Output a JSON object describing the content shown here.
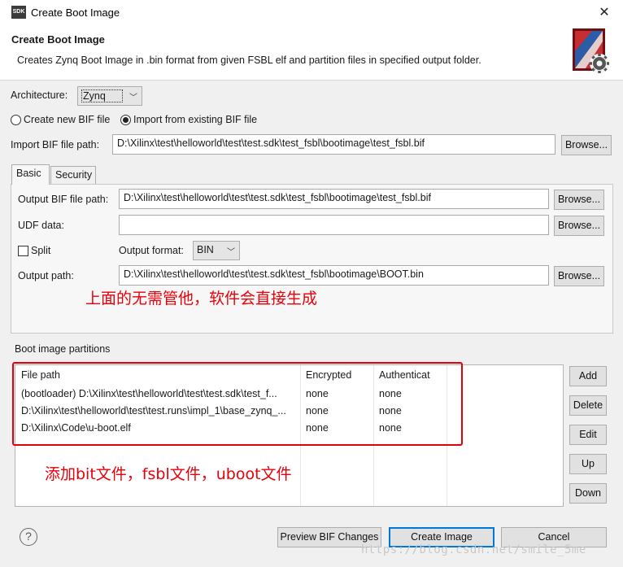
{
  "window": {
    "title": "Create Boot Image",
    "app_icon": "SDK",
    "close_icon": "close-icon"
  },
  "header": {
    "title": "Create Boot Image",
    "description": "Creates Zynq Boot Image in .bin format from given FSBL elf and partition files in specified output folder.",
    "icon": "boot-image-wizard-icon"
  },
  "architecture": {
    "label": "Architecture:",
    "value": "Zynq"
  },
  "bif_mode": {
    "create_new": {
      "label": "Create new BIF file",
      "selected": false
    },
    "import_existing": {
      "label": "Import from existing BIF file",
      "selected": true
    }
  },
  "import_bif": {
    "label": "Import BIF file path:",
    "value": "D:\\Xilinx\\test\\helloworld\\test\\test.sdk\\test_fsbl\\bootimage\\test_fsbl.bif",
    "browse": "Browse..."
  },
  "tabs": [
    {
      "label": "Basic",
      "active": true
    },
    {
      "label": "Security",
      "active": false
    }
  ],
  "basic": {
    "output_bif": {
      "label": "Output BIF file path:",
      "value": "D:\\Xilinx\\test\\helloworld\\test\\test.sdk\\test_fsbl\\bootimage\\test_fsbl.bif",
      "browse": "Browse..."
    },
    "udf": {
      "label": "UDF data:",
      "value": "",
      "browse": "Browse..."
    },
    "split": {
      "label": "Split",
      "checked": false
    },
    "output_format": {
      "label": "Output format:",
      "value": "BIN"
    },
    "output_path": {
      "label": "Output path:",
      "value": "D:\\Xilinx\\test\\helloworld\\test\\test.sdk\\test_fsbl\\bootimage\\BOOT.bin",
      "browse": "Browse..."
    }
  },
  "annotations": {
    "top": "上面的无需管他，软件会直接生成",
    "bottom": "添加bit文件，fsbl文件，uboot文件"
  },
  "partitions": {
    "label": "Boot image partitions",
    "columns": [
      "File path",
      "Encrypted",
      "Authenticat"
    ],
    "rows": [
      [
        "(bootloader) D:\\Xilinx\\test\\helloworld\\test\\test.sdk\\test_f...",
        "none",
        "none"
      ],
      [
        "D:\\Xilinx\\test\\helloworld\\test\\test.runs\\impl_1\\base_zynq_...",
        "none",
        "none"
      ],
      [
        "D:\\Xilinx\\Code\\u-boot.elf",
        "none",
        "none"
      ]
    ],
    "buttons": {
      "add": "Add",
      "delete": "Delete",
      "edit": "Edit",
      "up": "Up",
      "down": "Down"
    }
  },
  "footer": {
    "help_icon": "help-icon",
    "preview": "Preview BIF Changes",
    "create": "Create Image",
    "cancel": "Cancel"
  },
  "watermark": "https://blog.csdn.net/smile_5me"
}
